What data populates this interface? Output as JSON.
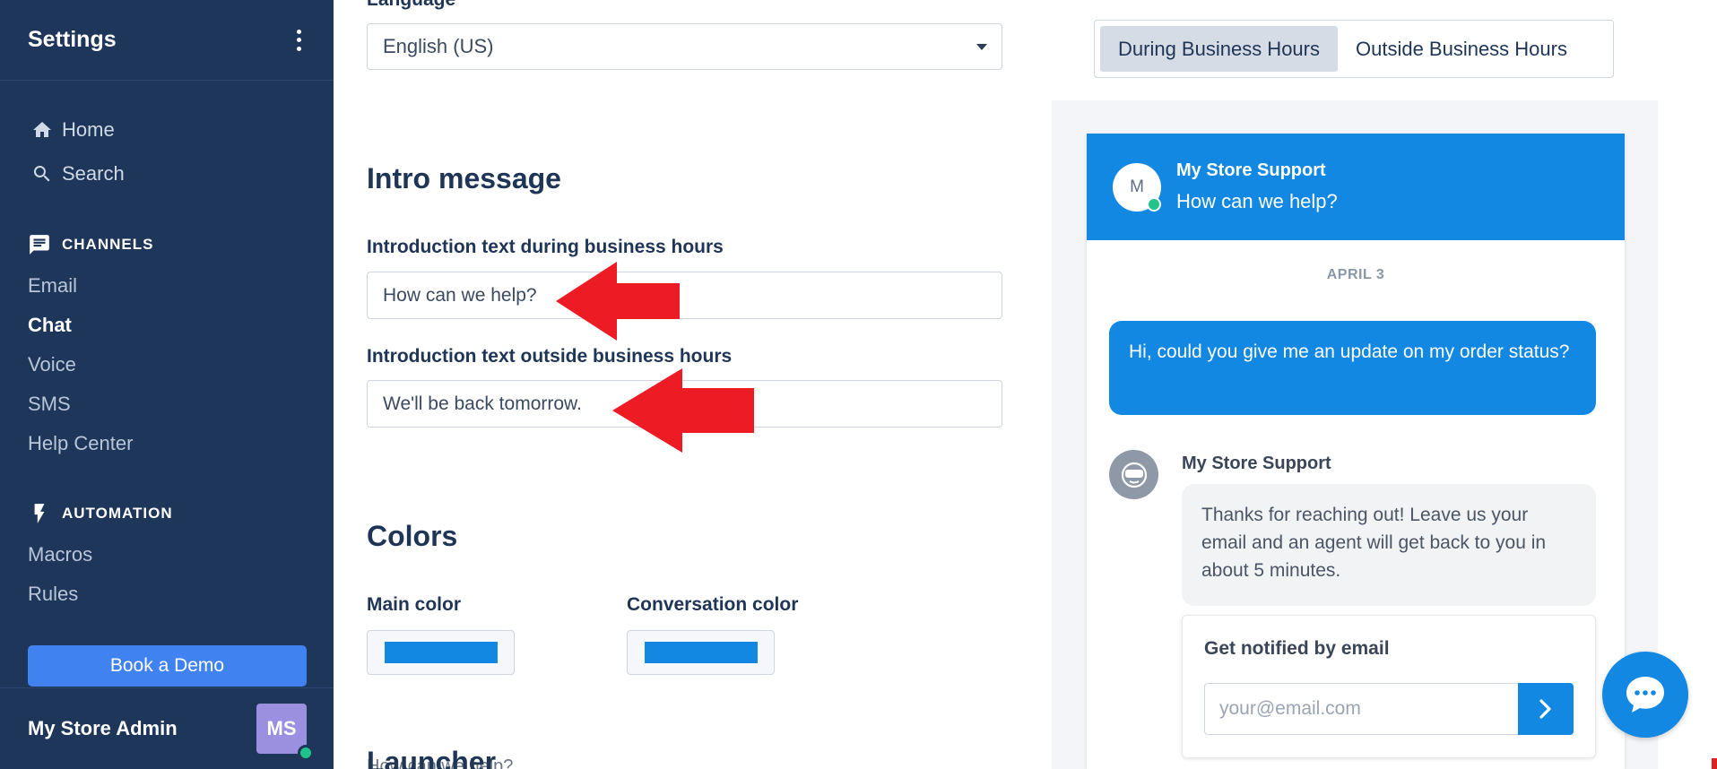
{
  "sidebar": {
    "title": "Settings",
    "nav": [
      {
        "label": "Home",
        "icon": "home-icon"
      },
      {
        "label": "Search",
        "icon": "search-icon"
      }
    ],
    "channels": {
      "header": "CHANNELS",
      "items": [
        "Email",
        "Chat",
        "Voice",
        "SMS",
        "Help Center"
      ],
      "active": "Chat"
    },
    "automation": {
      "header": "AUTOMATION",
      "items": [
        "Macros",
        "Rules"
      ]
    },
    "demo_button": "Book a Demo",
    "user_name": "My Store Admin",
    "user_initials": "MS"
  },
  "form": {
    "language_label": "Language",
    "language_value": "English (US)",
    "intro_heading": "Intro message",
    "intro_during_label": "Introduction text during business hours",
    "intro_during_value": "How can we help?",
    "intro_outside_label": "Introduction text outside business hours",
    "intro_outside_value": "We'll be back tomorrow.",
    "colors_heading": "Colors",
    "main_color_label": "Main color",
    "main_color": "#1288e3",
    "conversation_color_label": "Conversation color",
    "conversation_color": "#1288e3",
    "launcher_heading": "Launcher",
    "launcher_ghost_text": "How can we help?"
  },
  "annotations": {
    "arrow_color": "#ed1c24"
  },
  "preview": {
    "toggle": {
      "during": "During Business Hours",
      "outside": "Outside Business Hours",
      "active": "during"
    },
    "header_initial": "M",
    "header_name": "My Store Support",
    "header_sub": "How can we help?",
    "date": "APRIL 3",
    "customer_message": "Hi, could you give me an update on my order status?",
    "bot_name": "My Store Support",
    "bot_message": "Thanks for reaching out! Leave us your email and an agent will get back to you in about 5 minutes.",
    "email_card_title": "Get notified by email",
    "email_placeholder": "your@email.com"
  }
}
